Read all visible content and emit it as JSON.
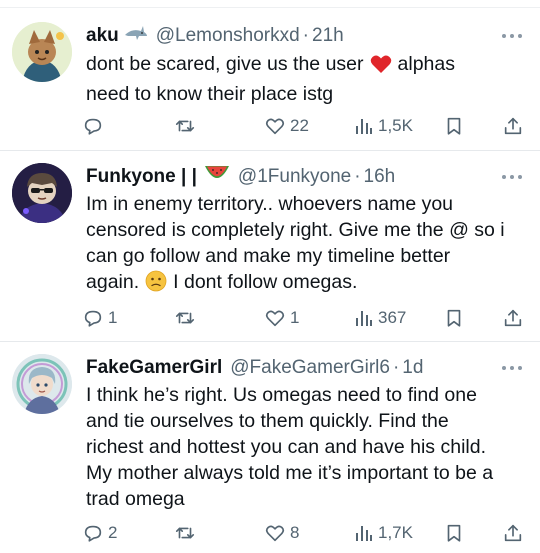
{
  "tweets": [
    {
      "name": "aku",
      "name_emoji": "shark-emoji",
      "handle": "@Lemonshorkxd",
      "separator": "·",
      "time": "21h",
      "text_lines": [
        "dont be scared, give us the user",
        "need to know their place istg"
      ],
      "text_line1_after_emoji": "alphas",
      "inline_emoji": "red-heart-emoji",
      "replies": "",
      "retweets": "",
      "likes": "22",
      "views": "1,5K"
    },
    {
      "name": "Funkyone | |",
      "name_emoji": "watermelon-emoji",
      "handle": "@1Funkyone",
      "separator": "·",
      "time": "16h",
      "text_lines": [
        "Im in enemy territory..  whoevers name you",
        "censored is completely right. Give me the @ so i",
        "can go follow and make my timeline better",
        "again."
      ],
      "text_line4_after_emoji": "I dont follow omegas.",
      "inline_emoji": "confused-face-emoji",
      "replies": "1",
      "retweets": "",
      "likes": "1",
      "views": "367"
    },
    {
      "name": "FakeGamerGirl",
      "handle": "@FakeGamerGirl6",
      "separator": "·",
      "time": "1d",
      "text_lines": [
        "I think he’s right. Us omegas need to find one",
        "and tie ourselves to them quickly. Find the",
        "richest and hottest you can and have his child.",
        "My mother always told me it’s important to be a",
        "trad omega"
      ],
      "replies": "2",
      "retweets": "",
      "likes": "8",
      "views": "1,7K"
    }
  ],
  "colors": {
    "text": "#0f1419",
    "secondary": "#536471",
    "divider": "#e6e9ec"
  }
}
